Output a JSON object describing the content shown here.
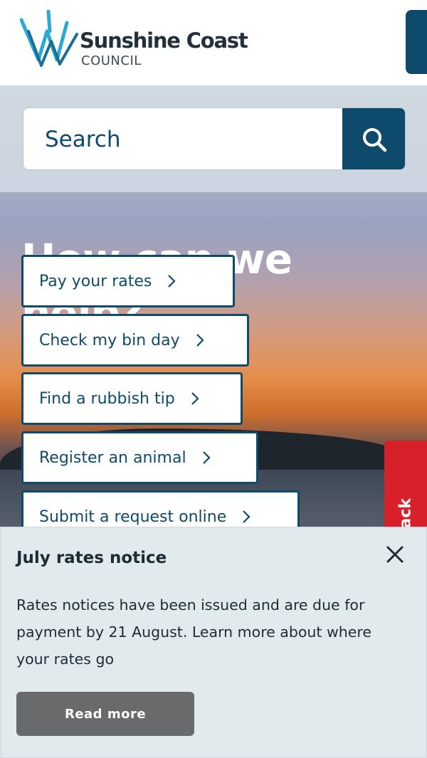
{
  "header": {
    "logo": {
      "name": "Sunshine Coast",
      "sub": "COUNCIL"
    },
    "menu_icon": "menu-icon"
  },
  "search": {
    "placeholder": "Search",
    "icon": "search-icon"
  },
  "hero": {
    "title_line1": "How can we",
    "title_line2": "help?"
  },
  "quick_links": [
    {
      "label": "Pay your rates"
    },
    {
      "label": "Check my bin day"
    },
    {
      "label": "Find a rubbish tip"
    },
    {
      "label": "Register an animal"
    },
    {
      "label": "Submit a request online"
    }
  ],
  "feedback": {
    "label": "Feedback"
  },
  "notice": {
    "title": "July rates notice",
    "body": "Rates notices have been issued and are due for payment by 21 August. Learn more about where your rates go",
    "button_label": "Read more",
    "close_icon": "close-icon"
  },
  "colors": {
    "brand": "#0e4a6b",
    "feedback": "#d8202b",
    "notice_bg": "#e3eaee",
    "read_more_button": "#686a6c"
  }
}
